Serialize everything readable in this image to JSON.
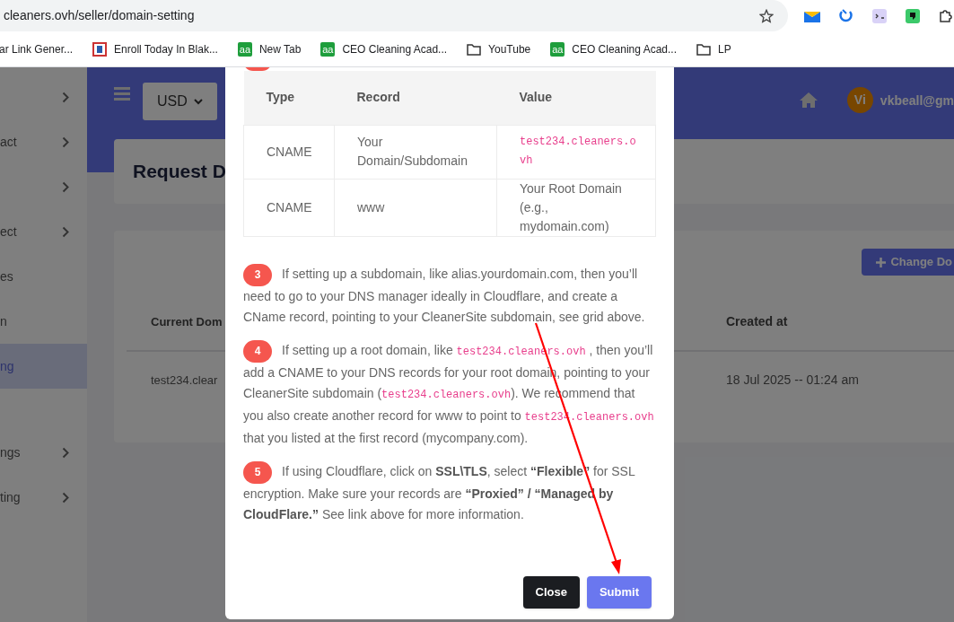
{
  "browser": {
    "url": "cleaners.ovh/seller/domain-setting",
    "bookmarks": [
      {
        "kind": "page",
        "label": "ar Link Gener..."
      },
      {
        "kind": "flag",
        "label": "Enroll Today In Blak..."
      },
      {
        "kind": "aa",
        "icon_text": "aa",
        "label": "New Tab"
      },
      {
        "kind": "aa",
        "icon_text": "aa",
        "label": "CEO Cleaning Acad..."
      },
      {
        "kind": "folder",
        "label": "YouTube"
      },
      {
        "kind": "aa",
        "icon_text": "aa",
        "label": "CEO Cleaning Acad..."
      },
      {
        "kind": "folder",
        "label": "LP"
      }
    ]
  },
  "sidebar": {
    "sections": [
      {
        "items": [
          {
            "chevron": true,
            "selected": false
          },
          {
            "label": "act",
            "chevron": true,
            "selected": false
          },
          {
            "chevron": true,
            "selected": false
          },
          {
            "label": "ect",
            "chevron": true,
            "selected": false
          },
          {
            "label": "es",
            "chevron": false,
            "selected": false
          },
          {
            "label": "n",
            "chevron": false,
            "selected": false
          },
          {
            "label": "ng",
            "chevron": false,
            "selected": true
          }
        ]
      },
      {
        "items": [
          {
            "label": "ngs",
            "chevron": true,
            "selected": false
          },
          {
            "label": "ting",
            "chevron": true,
            "selected": false
          }
        ]
      }
    ]
  },
  "navbar": {
    "currency": "USD",
    "avatar": "Vi",
    "user": "vkbeall@gm"
  },
  "page": {
    "title": "Request D",
    "action_button": "Change Do",
    "table": {
      "columns": [
        "Current Dom",
        "Created at"
      ],
      "rows": [
        [
          "test234.clear",
          "18 Jul 2025 -- 01:24 am"
        ]
      ]
    }
  },
  "modal": {
    "dns_table": {
      "columns": [
        "Type",
        "Record",
        "Value"
      ],
      "rows": [
        [
          {
            "kind": "text",
            "text": "CNAME"
          },
          {
            "kind": "text",
            "text": "Your Domain/Subdomain"
          },
          {
            "kind": "code",
            "text": "test234.cleaners.ovh"
          }
        ],
        [
          {
            "kind": "text",
            "text": "CNAME"
          },
          {
            "kind": "text",
            "text": "www"
          },
          {
            "kind": "text",
            "text": "Your Root Domain (e.g., mydomain.com)"
          }
        ]
      ]
    },
    "steps": [
      {
        "number": "3",
        "segments": [
          {
            "kind": "text",
            "text": "If setting up a subdomain, like alias.yourdomain.com, then you’ll need to go to your DNS manager ideally in Cloudflare, and create a CName record, pointing to your CleanerSite subdomain, see grid above."
          }
        ]
      },
      {
        "number": "4",
        "segments": [
          {
            "kind": "text",
            "text": "If setting up a root domain, like "
          },
          {
            "kind": "code",
            "text": "test234.cleaners.ovh"
          },
          {
            "kind": "text",
            "text": " , then you’ll add a CNAME to your DNS records for your root domain, pointing to your CleanerSite subdomain ("
          },
          {
            "kind": "code",
            "text": "test234.cleaners.ovh"
          },
          {
            "kind": "text",
            "text": "). We recommend that you also create another record for www to point to "
          },
          {
            "kind": "code",
            "text": "test234.cleaners.ovh"
          },
          {
            "kind": "text",
            "text": " that you listed at the first record (mycompany.com)."
          }
        ]
      },
      {
        "number": "5",
        "segments": [
          {
            "kind": "text",
            "text": "If using Cloudflare, click on **SSL\\TLS**, select **“Flexible”** for SSL encryption. Make sure your records are **“Proxied” / “Managed by CloudFlare.”** See link above for more information."
          }
        ]
      }
    ],
    "buttons": [
      {
        "kind": "dark",
        "label": "Close"
      },
      {
        "kind": "primary",
        "label": "Submit"
      }
    ]
  }
}
